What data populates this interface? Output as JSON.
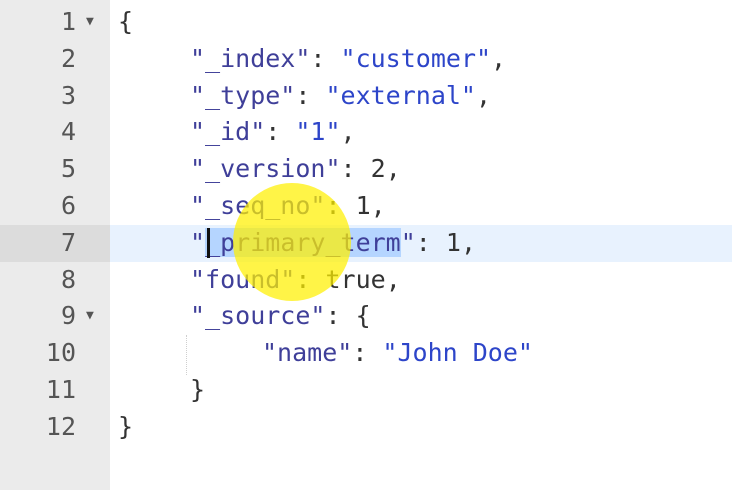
{
  "editor": {
    "lines": [
      {
        "n": "1",
        "fold": "▼",
        "parts": {
          "p1": "{"
        }
      },
      {
        "n": "2",
        "fold": "",
        "parts": {
          "k": "\"_index\"",
          "c": ": ",
          "v": "\"customer\"",
          "e": ","
        }
      },
      {
        "n": "3",
        "fold": "",
        "parts": {
          "k": "\"_type\"",
          "c": ": ",
          "v": "\"external\"",
          "e": ","
        }
      },
      {
        "n": "4",
        "fold": "",
        "parts": {
          "k": "\"_id\"",
          "c": ": ",
          "v": "\"1\"",
          "e": ","
        }
      },
      {
        "n": "5",
        "fold": "",
        "parts": {
          "k": "\"_version\"",
          "c": ": ",
          "v": "2",
          "e": ","
        }
      },
      {
        "n": "6",
        "fold": "",
        "parts": {
          "k": "\"_seq_no\"",
          "c": ": ",
          "v": "1",
          "e": ","
        }
      },
      {
        "n": "7",
        "fold": "",
        "parts": {
          "q1": "\"",
          "ksel": "_primary_term",
          "q2": "\"",
          "c": ": ",
          "v": "1",
          "e": ","
        }
      },
      {
        "n": "8",
        "fold": "",
        "parts": {
          "k": "\"found\"",
          "c": ": ",
          "v": "true",
          "e": ","
        }
      },
      {
        "n": "9",
        "fold": "▼",
        "parts": {
          "k": "\"_source\"",
          "c": ": ",
          "v": "{"
        }
      },
      {
        "n": "10",
        "fold": "",
        "parts": {
          "k": "\"name\"",
          "c": ": ",
          "v": "\"John Doe\""
        }
      },
      {
        "n": "11",
        "fold": "",
        "parts": {
          "p1": "}"
        }
      },
      {
        "n": "12",
        "fold": "",
        "parts": {
          "p1": "}"
        }
      }
    ],
    "active_line": "7",
    "colors": {
      "gutter": "#ebebeb",
      "active_line": "#e8f2fe",
      "selection": "#b5d5ff",
      "string": "#2d45c9",
      "key": "#3f3f99",
      "highlight": "#fff000"
    }
  }
}
